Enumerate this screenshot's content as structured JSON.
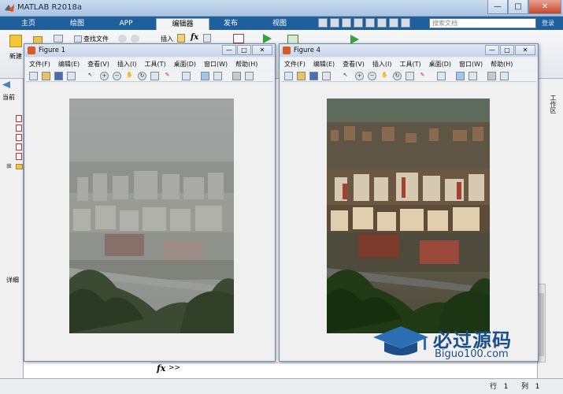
{
  "app": {
    "title": "MATLAB R2018a",
    "search_placeholder": "搜索文档",
    "login": "登录",
    "tabs": [
      "主页",
      "绘图",
      "APP",
      "编辑器",
      "发布",
      "视图"
    ],
    "active_tab": "编辑器"
  },
  "ribbon": {
    "new_label": "新建",
    "find_file_label": "查找文件",
    "insert_label": "插入",
    "fx_label": "fx"
  },
  "left_panel": {
    "current_folder": "当前",
    "details": "详细"
  },
  "right_panel": {
    "workspace": "工作区"
  },
  "command": {
    "fx": "fx",
    "prompt": ">>"
  },
  "status": {
    "row_label": "行",
    "row_value": "1",
    "col_label": "列",
    "col_value": "1"
  },
  "figures": [
    {
      "title": "Figure 1",
      "menu": [
        "文件(F)",
        "编辑(E)",
        "查看(V)",
        "插入(I)",
        "工具(T)",
        "桌面(D)",
        "窗口(W)",
        "帮助(H)"
      ]
    },
    {
      "title": "Figure 4",
      "menu": [
        "文件(F)",
        "编辑(E)",
        "查看(V)",
        "插入(I)",
        "工具(T)",
        "桌面(D)",
        "窗口(W)",
        "帮助(H)"
      ]
    }
  ],
  "watermark": {
    "cn": "必过源码",
    "url": "Biguo100.com"
  },
  "colors": {
    "tab_strip": "#1f5f9b",
    "title_bar": "#c9dbee"
  }
}
